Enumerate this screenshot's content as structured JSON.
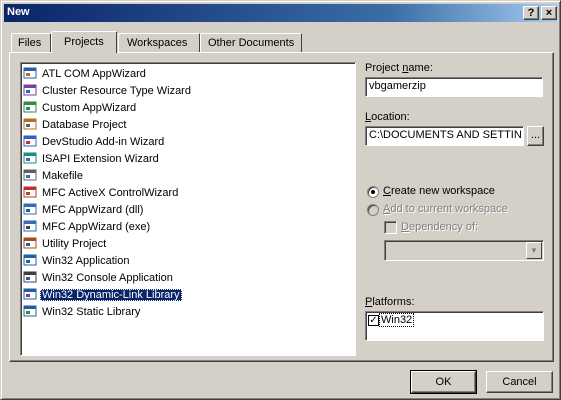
{
  "window": {
    "title": "New",
    "help_label": "?",
    "close_label": "×"
  },
  "tabs": [
    {
      "label": "Files"
    },
    {
      "label": "Projects"
    },
    {
      "label": "Workspaces"
    },
    {
      "label": "Other Documents"
    }
  ],
  "project_types": [
    {
      "label": "ATL COM AppWizard",
      "icon": "atl-icon"
    },
    {
      "label": "Cluster Resource Type Wizard",
      "icon": "cluster-icon"
    },
    {
      "label": "Custom AppWizard",
      "icon": "wizard-icon"
    },
    {
      "label": "Database Project",
      "icon": "database-icon"
    },
    {
      "label": "DevStudio Add-in Wizard",
      "icon": "addin-icon"
    },
    {
      "label": "ISAPI Extension Wizard",
      "icon": "globe-icon"
    },
    {
      "label": "Makefile",
      "icon": "makefile-icon"
    },
    {
      "label": "MFC ActiveX ControlWizard",
      "icon": "activex-icon"
    },
    {
      "label": "MFC AppWizard (dll)",
      "icon": "mfc-dll-icon"
    },
    {
      "label": "MFC AppWizard (exe)",
      "icon": "mfc-exe-icon"
    },
    {
      "label": "Utility Project",
      "icon": "utility-icon"
    },
    {
      "label": "Win32 Application",
      "icon": "win32-app-icon"
    },
    {
      "label": "Win32 Console Application",
      "icon": "console-icon"
    },
    {
      "label": "Win32 Dynamic-Link Library",
      "icon": "dll-icon",
      "selected": true
    },
    {
      "label": "Win32 Static Library",
      "icon": "lib-icon"
    }
  ],
  "project_name": {
    "label_pre": "Project ",
    "label_key": "n",
    "label_post": "ame:",
    "value": "vbgamerzip"
  },
  "location": {
    "label_key": "L",
    "label_post": "ocation:",
    "value": "C:\\DOCUMENTS AND SETTIN",
    "browse_label": "..."
  },
  "workspace": {
    "create_label_key": "C",
    "create_label_post": "reate new workspace",
    "add_label_key": "A",
    "add_label_post": "dd to current workspace",
    "dependency_label_key": "D",
    "dependency_label_post": "ependency of:"
  },
  "platforms": {
    "label_key": "P",
    "label_post": "latforms:",
    "items": [
      {
        "label": "Win32",
        "checked": true
      }
    ],
    "check_mark": "✓"
  },
  "buttons": {
    "ok": "OK",
    "cancel": "Cancel"
  },
  "colors": {
    "face": "#d4d0c8",
    "selection": "#0a246a",
    "title_start": "#0a246a",
    "title_end": "#a6caf0"
  }
}
